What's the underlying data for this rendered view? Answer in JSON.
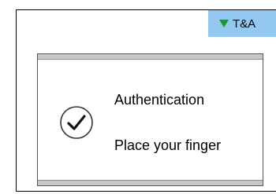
{
  "status_tab": {
    "label": "T&A",
    "icon": "triangle-down-icon",
    "icon_color": "#1a9a2a",
    "background": "#93c9f1"
  },
  "dialog": {
    "icon": "check-circle-icon",
    "title": "Authentication",
    "message": "Place your finger"
  }
}
